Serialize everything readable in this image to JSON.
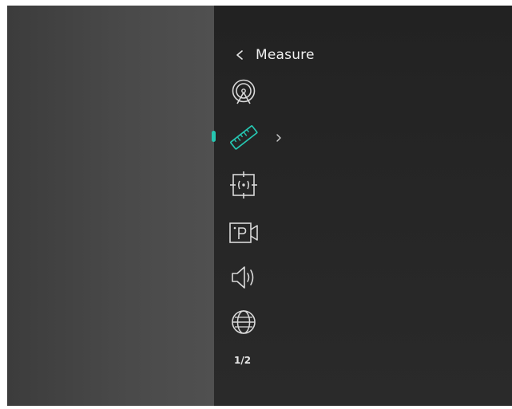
{
  "menu": {
    "title": "Measure",
    "items": [
      {
        "icon": "tripod-target-icon",
        "selected": false
      },
      {
        "icon": "ruler-icon",
        "selected": true,
        "has_submenu": true
      },
      {
        "icon": "auto-focus-frame-icon",
        "selected": false
      },
      {
        "icon": "picture-in-picture-record-icon",
        "selected": false
      },
      {
        "icon": "speaker-volume-icon",
        "selected": false
      },
      {
        "icon": "globe-language-icon",
        "selected": false
      }
    ],
    "page_indicator": "1/2"
  },
  "colors": {
    "accent": "#26c6b1",
    "icon": "#d9d9d9",
    "text": "#f0f0f0"
  }
}
